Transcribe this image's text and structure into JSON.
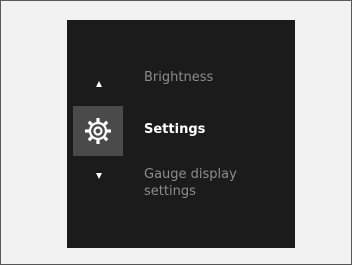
{
  "menu": {
    "items": [
      {
        "label": "Brightness",
        "state": "inactive"
      },
      {
        "label": "Settings",
        "state": "selected",
        "icon": "gear-icon"
      },
      {
        "label": "Gauge display\nsettings",
        "state": "inactive"
      }
    ],
    "up_icon": "up-arrow-icon",
    "down_icon": "down-arrow-icon"
  },
  "colors": {
    "page_bg": "#f2f2f2",
    "screen_bg": "#1b1b1b",
    "selected_tile": "#4a4a4a",
    "selected_text": "#ffffff",
    "inactive_text": "#8c8c8c"
  }
}
